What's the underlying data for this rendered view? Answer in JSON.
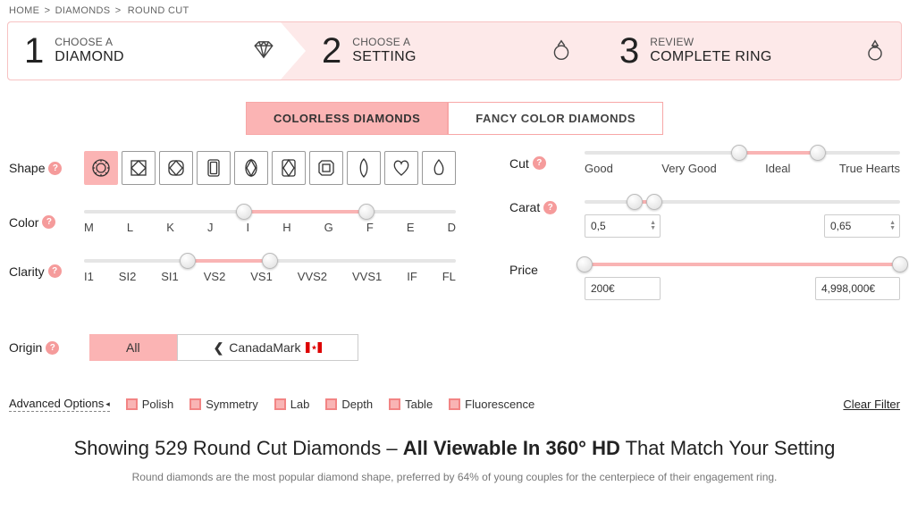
{
  "breadcrumb": {
    "home": "HOME",
    "sep": ">",
    "diamonds": "DIAMONDS",
    "current": "ROUND CUT"
  },
  "steps": {
    "s1": {
      "num": "1",
      "top": "CHOOSE A",
      "bottom": "DIAMOND"
    },
    "s2": {
      "num": "2",
      "top": "CHOOSE A",
      "bottom": "SETTING"
    },
    "s3": {
      "num": "3",
      "top": "REVIEW",
      "bottom": "COMPLETE RING"
    }
  },
  "tabs": {
    "colorless": "COLORLESS DIAMONDS",
    "fancy": "FANCY COLOR DIAMONDS"
  },
  "labels": {
    "shape": "Shape",
    "color": "Color",
    "clarity": "Clarity",
    "cut": "Cut",
    "carat": "Carat",
    "price": "Price",
    "origin": "Origin"
  },
  "color_scale": [
    "M",
    "L",
    "K",
    "J",
    "I",
    "H",
    "G",
    "F",
    "E",
    "D"
  ],
  "clarity_scale": [
    "I1",
    "SI2",
    "SI1",
    "VS2",
    "VS1",
    "VVS2",
    "VVS1",
    "IF",
    "FL"
  ],
  "cut_scale": [
    "Good",
    "Very Good",
    "Ideal",
    "True Hearts"
  ],
  "carat": {
    "min": "0,5",
    "max": "0,65"
  },
  "price": {
    "min": "200€",
    "max": "4,998,000€"
  },
  "origin": {
    "all": "All",
    "canadamark": "CanadaMark"
  },
  "adv": {
    "title": "Advanced Options",
    "opts": [
      "Polish",
      "Symmetry",
      "Lab",
      "Depth",
      "Table",
      "Fluorescence"
    ],
    "clear": "Clear Filter"
  },
  "results": {
    "pre": "Showing 529 Round Cut Diamonds – ",
    "strong": "All Viewable In 360° HD",
    "post": " That Match Your Setting",
    "sub": "Round diamonds are the most popular diamond shape, preferred by 64% of young couples for the centerpiece of their engagement ring."
  }
}
